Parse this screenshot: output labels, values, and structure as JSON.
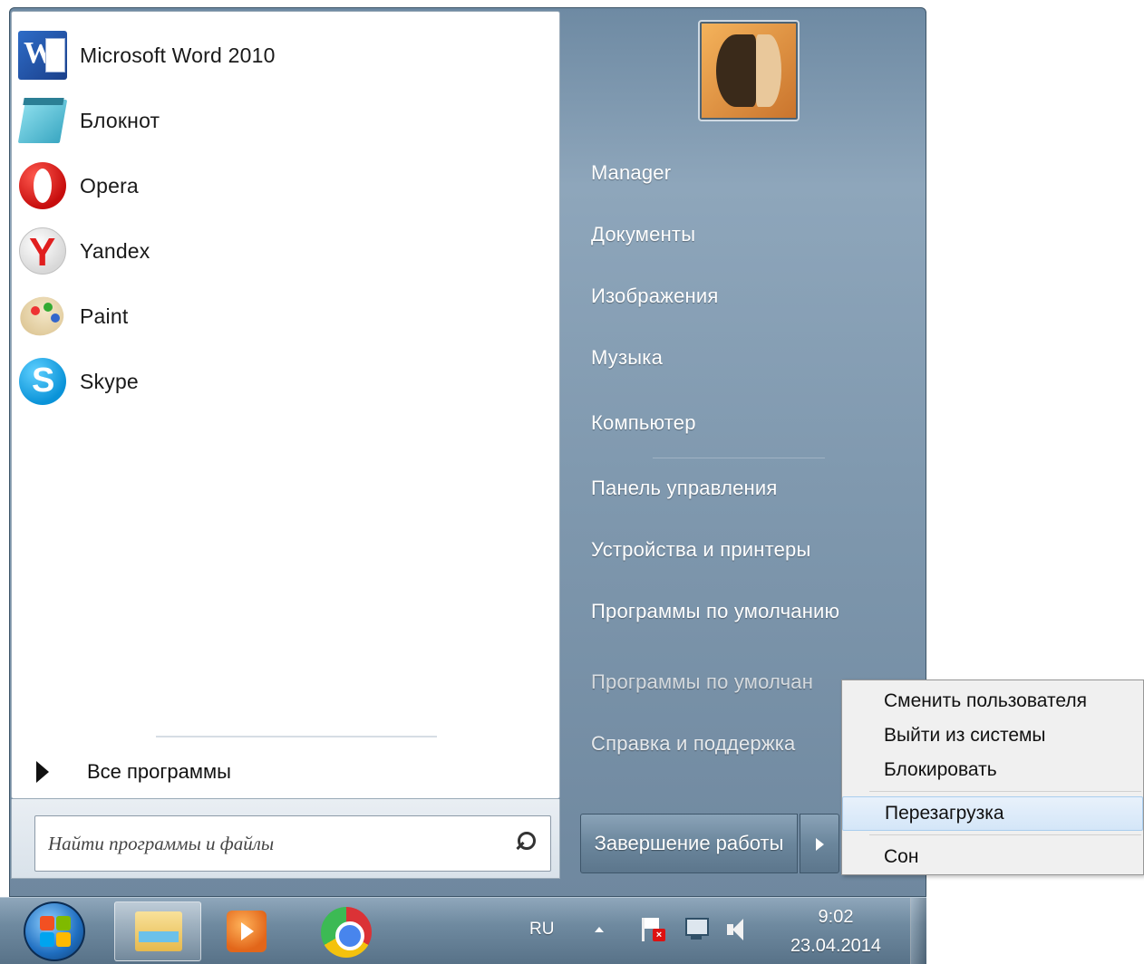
{
  "programs": [
    {
      "label": "Microsoft Word 2010",
      "icon": "word-icon"
    },
    {
      "label": "Блокнот",
      "icon": "notepad-icon"
    },
    {
      "label": "Opera",
      "icon": "opera-icon"
    },
    {
      "label": "Yandex",
      "icon": "yandex-icon"
    },
    {
      "label": "Paint",
      "icon": "paint-icon"
    },
    {
      "label": "Skype",
      "icon": "skype-icon"
    }
  ],
  "all_programs": {
    "label": "Все программы"
  },
  "search": {
    "placeholder": "Найти программы и файлы"
  },
  "places": [
    {
      "label": "Manager"
    },
    {
      "label": "Документы"
    },
    {
      "label": "Изображения"
    },
    {
      "label": "Музыка"
    },
    {
      "label": "Компьютер"
    },
    {
      "label": "Панель управления"
    },
    {
      "label": "Устройства и принтеры"
    },
    {
      "label": "Программы по умолчанию"
    },
    {
      "label": "Программы по умолчан"
    },
    {
      "label": "Справка и поддержка"
    }
  ],
  "shutdown": {
    "label": "Завершение работы"
  },
  "power_menu": {
    "items": [
      {
        "label": "Сменить пользователя"
      },
      {
        "label": "Выйти из системы"
      },
      {
        "label": "Блокировать"
      },
      {
        "label": "Перезагрузка"
      },
      {
        "label": "Сон"
      }
    ]
  },
  "taskbar": {
    "language": "RU",
    "time": "9:02",
    "date": "23.04.2014"
  },
  "colors": {
    "menu_right_pane": "#7f98ae",
    "taskbar": "#6f8aa0",
    "highlight": "#d4e6f8"
  }
}
